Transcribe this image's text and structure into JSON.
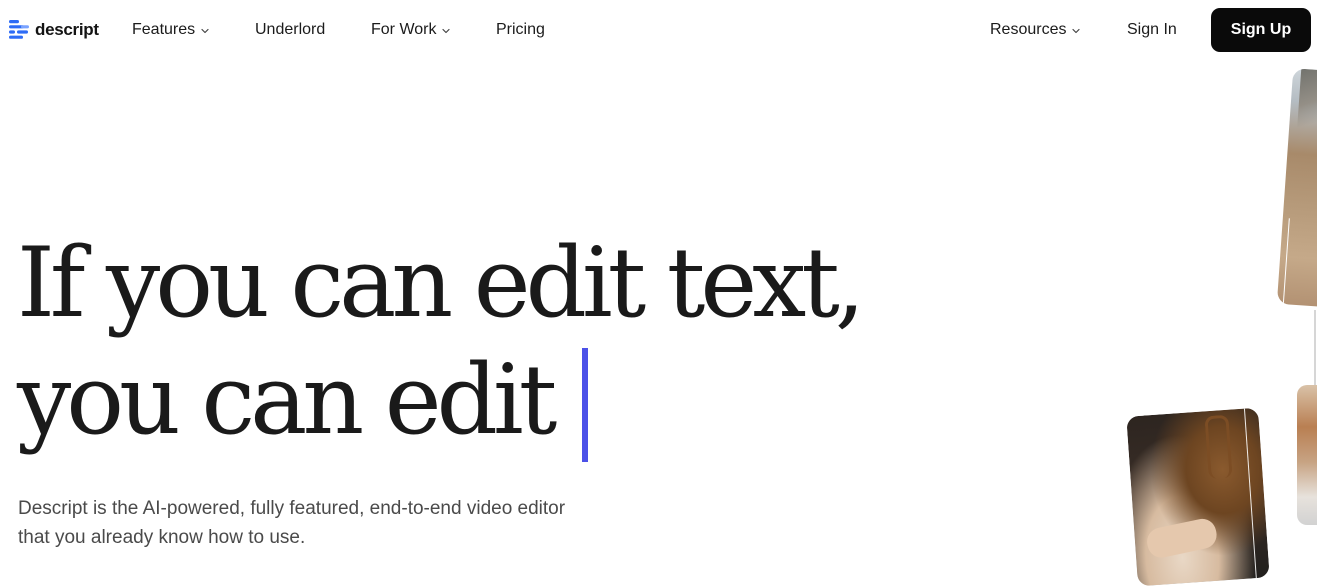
{
  "nav": {
    "logo_text": "descript",
    "items": [
      {
        "label": "Features",
        "has_dropdown": true
      },
      {
        "label": "Underlord",
        "has_dropdown": false
      },
      {
        "label": "For Work",
        "has_dropdown": true
      },
      {
        "label": "Pricing",
        "has_dropdown": false
      },
      {
        "label": "Resources",
        "has_dropdown": true
      },
      {
        "label": "Sign In",
        "has_dropdown": false
      }
    ],
    "signup_label": "Sign Up"
  },
  "hero": {
    "title_line_1": "If you can edit text,",
    "title_line_2": "you can edit",
    "subtitle_line_1": "Descript is the AI-powered, fully featured, end-to-end video editor",
    "subtitle_line_2": "that you already know how to use."
  },
  "colors": {
    "brand_blue": "#2e6cf6",
    "cursor_indigo": "#4c51e8",
    "button_black": "#0a0a0a"
  },
  "icons": {
    "logo": "descript-logo-icon",
    "dropdown": "chevron-down-icon"
  }
}
